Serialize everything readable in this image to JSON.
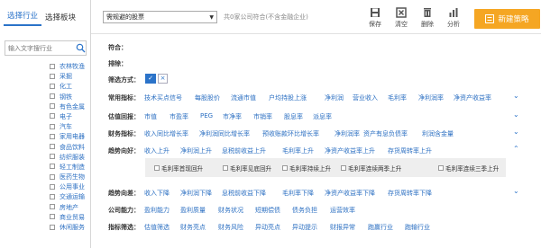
{
  "left_panel": {
    "tabs": [
      {
        "label": "选择行业",
        "active": true
      },
      {
        "label": "选择板块",
        "active": false
      }
    ],
    "search_placeholder": "输入文字搜行业",
    "industries": [
      "农林牧渔",
      "采掘",
      "化工",
      "钢铁",
      "有色金属",
      "电子",
      "汽车",
      "家用电器",
      "食品饮料",
      "纺织服装",
      "轻工制造",
      "医药生物",
      "公用事业",
      "交通运输",
      "房地产",
      "商业贸易",
      "休闲服务"
    ]
  },
  "topbar": {
    "strategy_select": "需规避的股票",
    "count_text": "共0家公司符合(不含金融企业)",
    "tools": [
      {
        "label": "保存",
        "icon": "save-icon"
      },
      {
        "label": "清空",
        "icon": "clear-icon"
      },
      {
        "label": "删除",
        "icon": "delete-icon"
      },
      {
        "label": "分析",
        "icon": "analysis-icon"
      }
    ],
    "new_strategy": "新建策略"
  },
  "filters": {
    "match_label": "符合：",
    "exclude_label": "排除：",
    "method_label": "筛选方式：",
    "method_on": "✓",
    "method_off": "×",
    "common": {
      "label": "常用指标：",
      "options": [
        "技术买点信号",
        "每股股价",
        "流通市值",
        "户均持股上涨",
        "净利润",
        "营业收入",
        "毛利率",
        "净利润率",
        "净资产收益率"
      ]
    },
    "valuation": {
      "label": "估值回报：",
      "options": [
        "市值",
        "市盈率",
        "PEG",
        "市净率",
        "市销率",
        "股息率",
        "派息率"
      ]
    },
    "finance": {
      "label": "财务指标：",
      "options": [
        "收入同比增长率",
        "净利润同比增长率",
        "预收账款环比增长率",
        "净利润率",
        "资产有息负债率",
        "利润含金量"
      ]
    },
    "trend_up": {
      "label": "趋势向好：",
      "options": [
        "收入上升",
        "净利润上升",
        "息税前收益上升",
        "毛利率上升",
        "净资产收益率上升",
        "存货周转率上升"
      ],
      "sub_options": [
        "毛利率首现回升",
        "毛利率见底回升",
        "毛利率持续上升",
        "毛利率连续两季上升",
        "毛利率连续三季上升"
      ]
    },
    "trend_down": {
      "label": "趋势向差：",
      "options": [
        "收入下降",
        "净利润下降",
        "息税前收益下降",
        "毛利率下降",
        "净资产收益率下降",
        "存货周转率下降"
      ]
    },
    "ability": {
      "label": "公司能力：",
      "options": [
        "盈利能力",
        "盈利质量",
        "财务状况",
        "短期偿债",
        "债务负担",
        "运营效率"
      ]
    },
    "indicator": {
      "label": "指标筛选：",
      "options": [
        "估值筛选",
        "财务亮点",
        "财务风险",
        "异动亮点",
        "异动提示",
        "财报异常",
        "跑赢行业",
        "跑输行业"
      ]
    }
  }
}
